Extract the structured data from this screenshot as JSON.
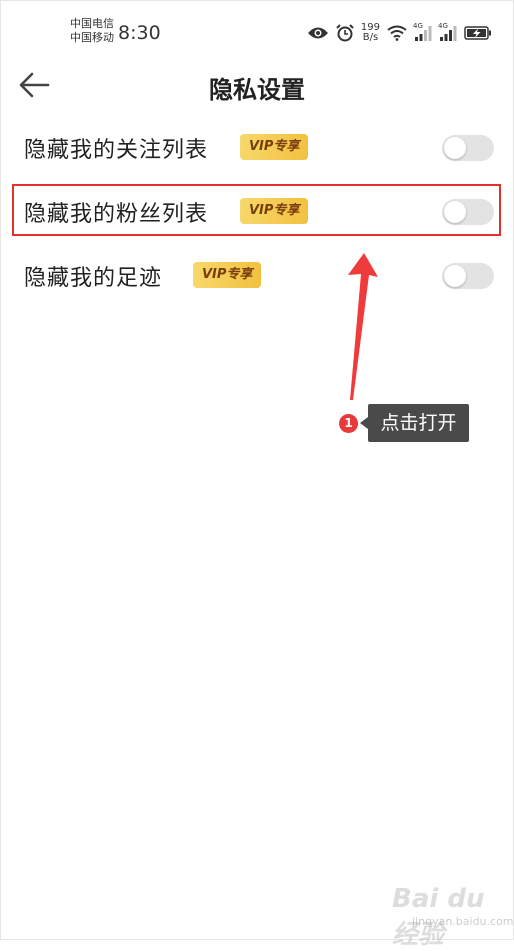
{
  "status_bar": {
    "carrier_1": "中国电信",
    "carrier_2": "中国移动",
    "time": "8:30",
    "net_speed_value": "199",
    "net_speed_unit": "B/s",
    "network_1": "4G",
    "network_2": "4G",
    "icons": [
      "eye-icon",
      "alarm-icon",
      "wifi-icon",
      "signal-icon",
      "signal-icon",
      "battery-charging-icon"
    ]
  },
  "header": {
    "title": "隐私设置",
    "back_icon": "arrow-left-icon"
  },
  "settings": [
    {
      "label": "隐藏我的关注列表",
      "badge": "VIP专享",
      "enabled": false
    },
    {
      "label": "隐藏我的粉丝列表",
      "badge": "VIP专享",
      "enabled": false
    },
    {
      "label": "隐藏我的足迹",
      "badge": "VIP专享",
      "enabled": false
    }
  ],
  "annotation": {
    "step_number": "1",
    "text": "点击打开"
  },
  "watermark": {
    "logo": "Bai du 经验",
    "sub": "jingyan.baidu.com"
  },
  "colors": {
    "highlight_border": "#e1322d",
    "badge_bg": "#f4c84a",
    "badge_text": "#7a3e0a",
    "toggle_off": "#e3e3e3",
    "arrow": "#ef3b3b",
    "callout_bg": "#4a4a4a"
  }
}
